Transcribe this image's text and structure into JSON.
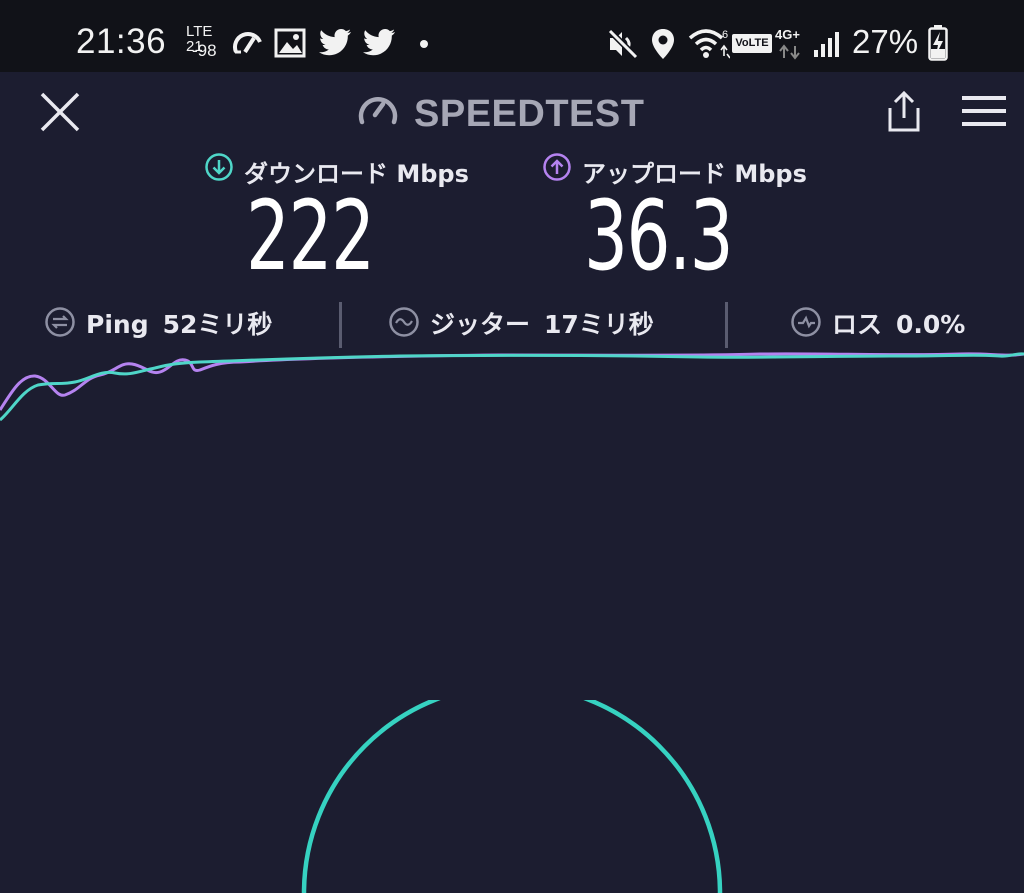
{
  "status_bar": {
    "time": "21:36",
    "lte_label": "LTE 21",
    "lte_signal": "-98",
    "volte": "VoLTE",
    "network": "4G+",
    "battery_percent": "27%",
    "icons": [
      "speedtest-icon",
      "gallery-icon",
      "twitter-icon",
      "twitter-icon",
      "notification-dot-icon",
      "mute-icon",
      "location-icon",
      "wifi-icon",
      "volte-icon",
      "network-4g-icon",
      "cell-signal-icon",
      "battery-charging-icon"
    ]
  },
  "header": {
    "title": "SPEEDTEST",
    "icons": [
      "close-icon",
      "gauge-logo-icon",
      "share-icon",
      "menu-icon"
    ]
  },
  "download": {
    "label": "ダウンロード Mbps",
    "value": "222",
    "color": "#4fd6c8"
  },
  "upload": {
    "label": "アップロード Mbps",
    "value": "36.3",
    "color": "#b583f0"
  },
  "stats": {
    "ping": {
      "label": "Ping",
      "value": "52ミリ秒"
    },
    "jitter": {
      "label": "ジッター",
      "value": "17ミリ秒"
    },
    "loss": {
      "label": "ロス",
      "value": "0.0%"
    }
  },
  "colors": {
    "background": "#1c1d30",
    "status_bar": "#111218",
    "download_line": "#4fd6c8",
    "upload_line": "#b583f0",
    "gauge": "#36d2c1"
  }
}
